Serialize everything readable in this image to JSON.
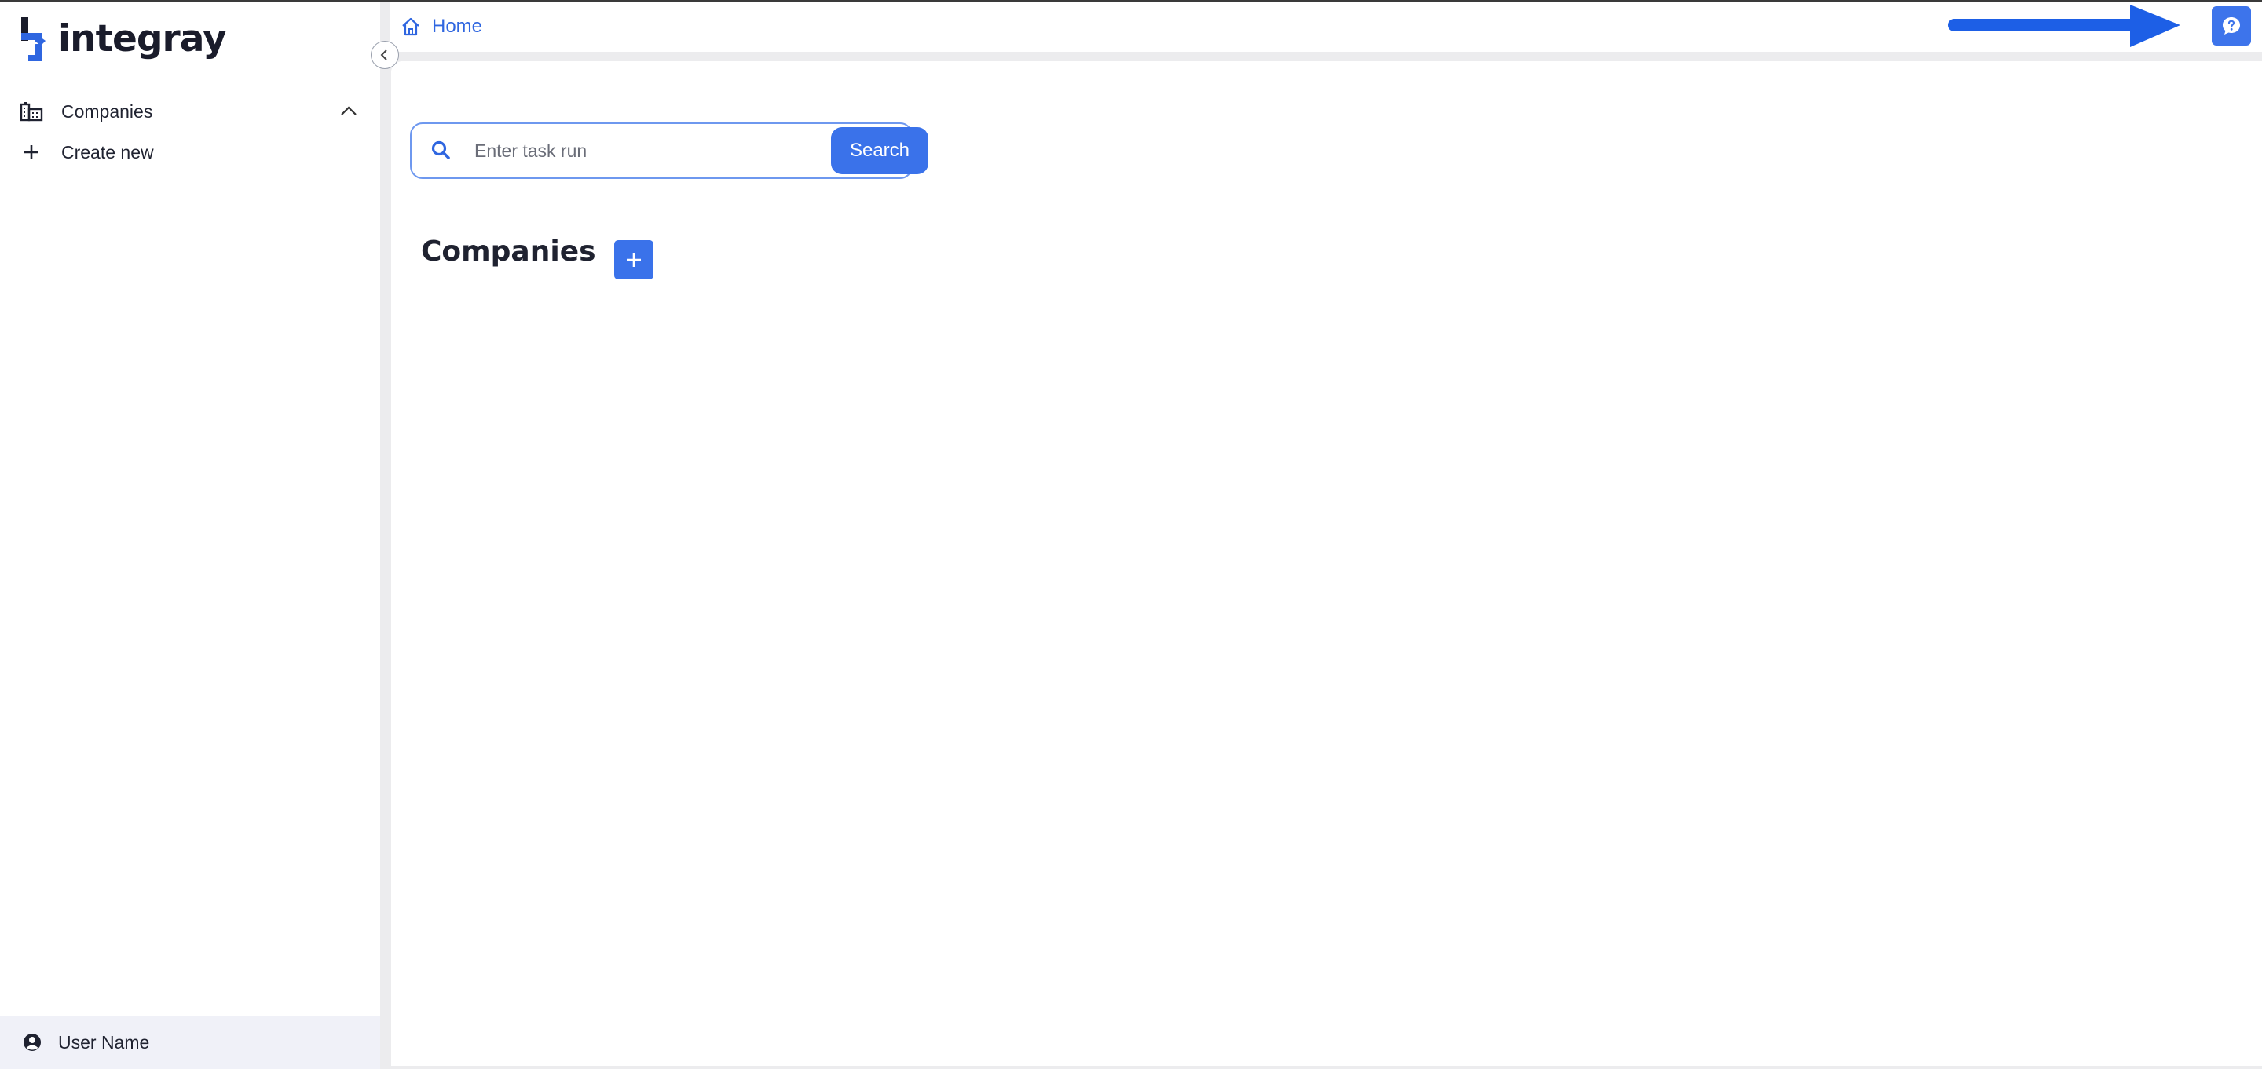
{
  "app": {
    "brand": "integray",
    "brand_color": "#2f66e0"
  },
  "sidebar": {
    "items": [
      {
        "label": "Companies",
        "icon": "buildings-icon",
        "expanded": true
      },
      {
        "label": "Create new",
        "icon": "plus-icon"
      }
    ],
    "user": {
      "label": "User Name",
      "icon": "user-circle-icon"
    }
  },
  "header": {
    "breadcrumb": {
      "label": "Home",
      "icon": "home-icon"
    },
    "help_icon": "chat-question-icon"
  },
  "main": {
    "search": {
      "placeholder": "Enter task run",
      "value": "",
      "button_label": "Search"
    },
    "section": {
      "title": "Companies",
      "add_icon": "plus-icon"
    }
  },
  "annotation": {
    "type": "arrow",
    "color": "#1d5fe6",
    "points_to": "chat-question-icon"
  }
}
